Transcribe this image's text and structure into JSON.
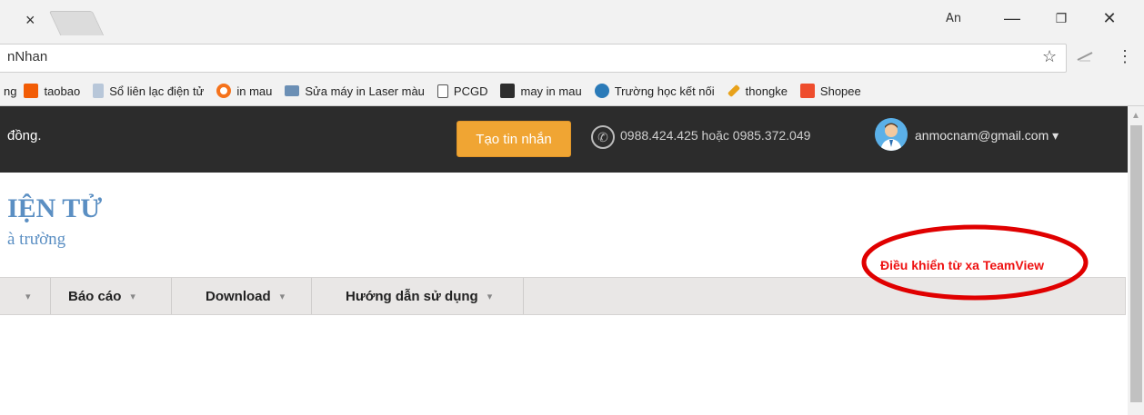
{
  "browser": {
    "tab_close": "×",
    "profile_name": "An",
    "controls": {
      "minimize": "—",
      "maximize": "❐",
      "close": "✕"
    },
    "address": "nNhan",
    "star_icon": "☆",
    "menu_icon": "⋮",
    "bookmarks": [
      {
        "label": "ng",
        "icon": "none",
        "color": "#f2f2f2"
      },
      {
        "label": "taobao",
        "icon": "taobao-icon",
        "color": "#f25c05"
      },
      {
        "label": "Sổ liên lạc điện tử",
        "icon": "document-icon",
        "color": "#b8c7d9"
      },
      {
        "label": "in mau",
        "icon": "circle-icon",
        "color": "#f5721b"
      },
      {
        "label": "Sửa máy in Laser màu",
        "icon": "printer-icon",
        "color": "#6b8fb5"
      },
      {
        "label": "PCGD",
        "icon": "page-icon",
        "color": "#ffffff"
      },
      {
        "label": "may in mau",
        "icon": "app-icon",
        "color": "#2d2d2d"
      },
      {
        "label": "Trường học kết nối",
        "icon": "people-icon",
        "color": "#2a7ab8"
      },
      {
        "label": "thongke",
        "icon": "pencil-icon",
        "color": "#e8a21b"
      },
      {
        "label": "Shopee",
        "icon": "shopee-icon",
        "color": "#ee4d2d"
      }
    ]
  },
  "site": {
    "top_text": "đồng.",
    "create_button": "Tạo tin nhắn",
    "phone_icon": "✆",
    "phone": "0988.424.425 hoặc 0985.372.049",
    "user_email": "anmocnam@gmail.com ▾",
    "logo_title": "IỆN TỬ",
    "logo_subtitle": "à trường",
    "remote_link": "Điều khiển từ xa TeamView",
    "accent_color": "#f0a533",
    "highlight_color": "#ee1111"
  },
  "nav": {
    "caret": "▾",
    "items": [
      {
        "label": ""
      },
      {
        "label": "Báo cáo"
      },
      {
        "label": "Download"
      },
      {
        "label": "Hướng dẫn sử dụng"
      }
    ]
  },
  "scrollbar": {
    "up_arrow": "▲"
  }
}
